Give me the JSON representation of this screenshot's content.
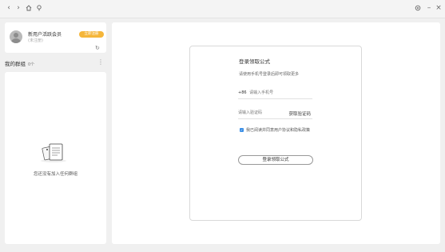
{
  "titlebar": {
    "icons": [
      "chevron-left-icon",
      "chevron-right-icon",
      "home-icon",
      "pin-icon",
      "settings-icon",
      "minimize-icon",
      "close-icon"
    ]
  },
  "sidebar": {
    "account": {
      "name": "新用户活跃会员",
      "subtitle": "(未注册)",
      "badge": "立即注册"
    },
    "section": {
      "title": "我的群组",
      "count": "0个"
    },
    "empty_text": "您还没有加入任何群组"
  },
  "login": {
    "title": "登录领取公式",
    "description": "请使用手机号登录后即可领取更多",
    "phone_prefix": "+86",
    "phone_placeholder": "请输入手机号",
    "code_placeholder": "请输入验证码",
    "get_code_label": "获取验证码",
    "agreement_text": "我已阅读并同意用户协议和隐私政策",
    "submit_label": "登录领取公式"
  },
  "colors": {
    "accent_badge": "#f5b63a",
    "checkbox": "#3a8ee6"
  }
}
